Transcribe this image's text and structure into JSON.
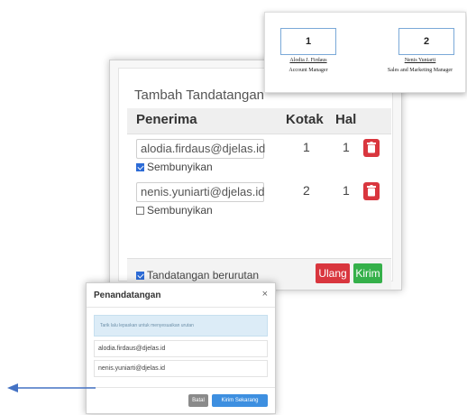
{
  "preview": {
    "signers": [
      {
        "number": "1",
        "name": "Alodia J. Firdaus",
        "role": "Account Manager"
      },
      {
        "number": "2",
        "name": "Nenis Yuniarti",
        "role": "Sales and Marketing Manager"
      }
    ]
  },
  "dialog": {
    "title": "Tambah Tandatangan",
    "headers": {
      "recipient": "Penerima",
      "box": "Kotak",
      "page": "Hal"
    },
    "recipients": [
      {
        "email": "alodia.firdaus@djelas.id",
        "box": "1",
        "page": "1",
        "hide_label": "Sembunyikan",
        "hide_checked": true
      },
      {
        "email": "nenis.yuniarti@djelas.id",
        "box": "2",
        "page": "1",
        "hide_label": "Sembunyikan",
        "hide_checked": false
      }
    ],
    "sequential_label": "Tandatangan berurutan",
    "sequential_checked": true,
    "reset_label": "Ulang",
    "send_label": "Kirim",
    "colors": {
      "danger": "#d9363e",
      "success": "#35b04a"
    }
  },
  "modal": {
    "title": "Penandatangan",
    "close_glyph": "×",
    "info": "Tarik lalu lepaskan untuk menyesuaikan urutan",
    "items": [
      "alodia.firdaus@djelas.id",
      "nenis.yuniarti@djelas.id"
    ],
    "cancel_label": "Batal",
    "send_now_label": "Kirim Sekarang",
    "colors": {
      "cancel": "#8a8a8a",
      "primary": "#3d8fe0"
    }
  },
  "arrow": {
    "color": "#4472c4"
  }
}
